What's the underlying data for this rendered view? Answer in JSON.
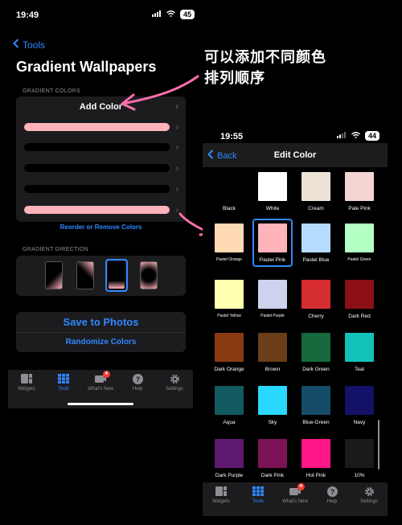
{
  "left_screen": {
    "status": {
      "time": "19:49",
      "battery": "45"
    },
    "back_label": "Tools",
    "title": "Gradient Wallpapers",
    "gradient_colors": {
      "section_label": "GRADIENT COLORS",
      "add_label": "Add Color",
      "swatches": [
        "#ffb3ba",
        "#000000",
        "#000000",
        "#000000",
        "#ffb3ba"
      ],
      "reorder_label": "Reorder or Remove Colors"
    },
    "gradient_direction": {
      "section_label": "GRADIENT DIRECTION",
      "selected_index": 2
    },
    "save_label": "Save to Photos",
    "randomize_label": "Randomize Colors",
    "tabs": [
      {
        "label": "Widgets",
        "icon": "widgets-icon"
      },
      {
        "label": "Tools",
        "icon": "tools-grid-icon",
        "active": true
      },
      {
        "label": "What's New",
        "icon": "whats-new-icon",
        "badge": true
      },
      {
        "label": "Help",
        "icon": "help-icon"
      },
      {
        "label": "Settings",
        "icon": "settings-gear-icon"
      }
    ]
  },
  "annotation": {
    "line1": "可以添加不同颜色",
    "line2": "排列顺序",
    "arrow_color": "#ff6fae"
  },
  "right_screen": {
    "status": {
      "time": "19:55",
      "battery": "44"
    },
    "back_label": "Back",
    "title": "Edit Color",
    "selected": "Pastel Pink",
    "colors": [
      {
        "name": "Black",
        "hex": "#000000"
      },
      {
        "name": "White",
        "hex": "#ffffff"
      },
      {
        "name": "Cream",
        "hex": "#ede2d6"
      },
      {
        "name": "Pale Pink",
        "hex": "#f5d5d3"
      },
      {
        "name": "Pastel Orange",
        "hex": "#ffd9b3"
      },
      {
        "name": "Pastel Pink",
        "hex": "#ffb3ba"
      },
      {
        "name": "Pastel Blue",
        "hex": "#b5dcff"
      },
      {
        "name": "Pastel Green",
        "hex": "#b3ffc4"
      },
      {
        "name": "Pastel Yellow",
        "hex": "#ffffb0"
      },
      {
        "name": "Pastel Purple",
        "hex": "#cfd2ee"
      },
      {
        "name": "Cherry",
        "hex": "#d62d33"
      },
      {
        "name": "Dark Red",
        "hex": "#8b0f14"
      },
      {
        "name": "Dark Orange",
        "hex": "#8a3a11"
      },
      {
        "name": "Brown",
        "hex": "#6b3e17"
      },
      {
        "name": "Dark Green",
        "hex": "#16693c"
      },
      {
        "name": "Teal",
        "hex": "#12c2b8"
      },
      {
        "name": "Aqua",
        "hex": "#135960"
      },
      {
        "name": "Sky",
        "hex": "#2ad8ff"
      },
      {
        "name": "Blue-Green",
        "hex": "#154c68"
      },
      {
        "name": "Navy",
        "hex": "#131268"
      },
      {
        "name": "Dark Purple",
        "hex": "#5f1870"
      },
      {
        "name": "Dark Pink",
        "hex": "#7d1357"
      },
      {
        "name": "Hot Pink",
        "hex": "#ff1689"
      },
      {
        "name": "10%",
        "hex": "#1a1a1a"
      }
    ],
    "tabs": [
      {
        "label": "Widgets",
        "icon": "widgets-icon"
      },
      {
        "label": "Tools",
        "icon": "tools-grid-icon",
        "active": true
      },
      {
        "label": "What's New",
        "icon": "whats-new-icon",
        "badge": true
      },
      {
        "label": "Help",
        "icon": "help-icon"
      },
      {
        "label": "Settings",
        "icon": "settings-gear-icon"
      }
    ]
  }
}
